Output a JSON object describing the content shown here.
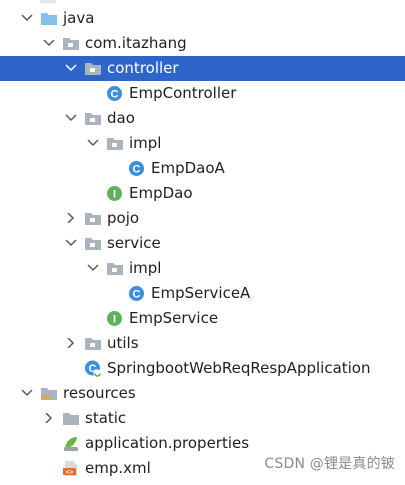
{
  "tree": [
    {
      "id": "java",
      "label": "java",
      "icon": "source-folder-icon",
      "chevron": "down",
      "depth": 1
    },
    {
      "id": "pkg-root",
      "label": "com.itazhang",
      "icon": "package-icon",
      "chevron": "down",
      "depth": 2
    },
    {
      "id": "controller",
      "label": "controller",
      "icon": "package-icon",
      "chevron": "down",
      "depth": 3,
      "selected": true
    },
    {
      "id": "empcontroller",
      "label": "EmpController",
      "icon": "class-icon",
      "chevron": "none",
      "depth": 4
    },
    {
      "id": "dao",
      "label": "dao",
      "icon": "package-icon",
      "chevron": "down",
      "depth": 3
    },
    {
      "id": "dao-impl",
      "label": "impl",
      "icon": "package-icon",
      "chevron": "down",
      "depth": 4
    },
    {
      "id": "empdaoa",
      "label": "EmpDaoA",
      "icon": "class-icon",
      "chevron": "none",
      "depth": 5
    },
    {
      "id": "empdao",
      "label": "EmpDao",
      "icon": "interface-icon",
      "chevron": "none",
      "depth": 4
    },
    {
      "id": "pojo",
      "label": "pojo",
      "icon": "package-icon",
      "chevron": "right",
      "depth": 3
    },
    {
      "id": "service",
      "label": "service",
      "icon": "package-icon",
      "chevron": "down",
      "depth": 3
    },
    {
      "id": "service-impl",
      "label": "impl",
      "icon": "package-icon",
      "chevron": "down",
      "depth": 4
    },
    {
      "id": "empservicea",
      "label": "EmpServiceA",
      "icon": "class-icon",
      "chevron": "none",
      "depth": 5
    },
    {
      "id": "empservice",
      "label": "EmpService",
      "icon": "interface-icon",
      "chevron": "none",
      "depth": 4
    },
    {
      "id": "utils",
      "label": "utils",
      "icon": "package-icon",
      "chevron": "right",
      "depth": 3
    },
    {
      "id": "app",
      "label": "SpringbootWebReqRespApplication",
      "icon": "spring-boot-class-icon",
      "chevron": "none",
      "depth": 3
    },
    {
      "id": "resources",
      "label": "resources",
      "icon": "resources-folder-icon",
      "chevron": "down",
      "depth": 1
    },
    {
      "id": "static",
      "label": "static",
      "icon": "folder-icon",
      "chevron": "right",
      "depth": 2
    },
    {
      "id": "app-props",
      "label": "application.properties",
      "icon": "properties-icon",
      "chevron": "none",
      "depth": 2
    },
    {
      "id": "emp-xml",
      "label": "emp.xml",
      "icon": "xml-file-icon",
      "chevron": "none",
      "depth": 2
    }
  ],
  "watermark": "CSDN @锂是真的铍",
  "colors": {
    "selection": "#2f65ca",
    "folder": "#aab4bf",
    "class": "#3d8fdd",
    "interface": "#5fb25a",
    "source_folder": "#7fc3e6"
  }
}
